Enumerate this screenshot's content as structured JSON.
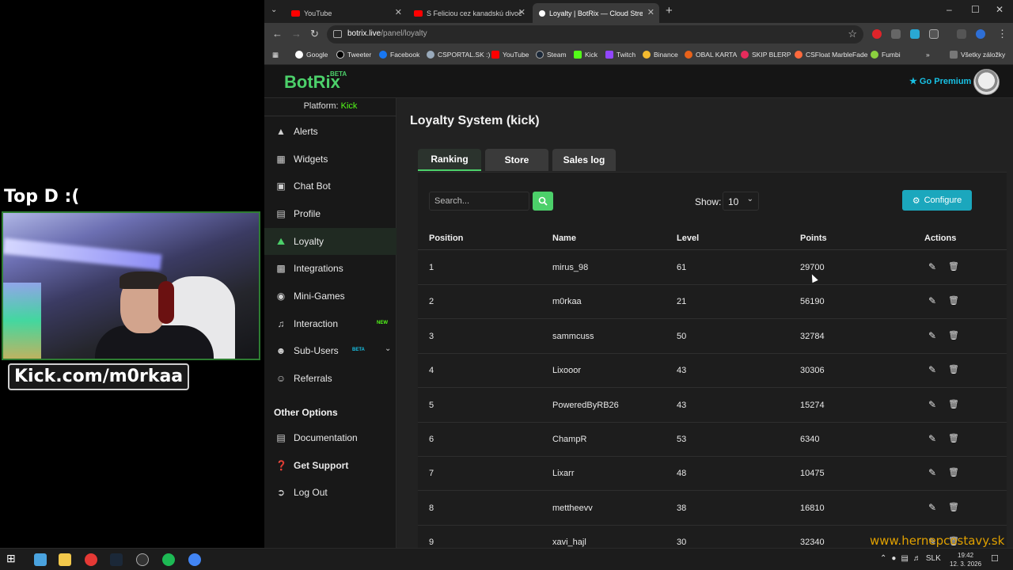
{
  "overlay": {
    "caption": "Top D :(",
    "kick_channel": "Kick.com/m0rkaa"
  },
  "browser": {
    "tabs": [
      {
        "title": "YouTube",
        "icon": "youtube-icon"
      },
      {
        "title": "S Feliciou cez kanadskú divočin",
        "icon": "youtube-icon"
      },
      {
        "title": "Loyalty | BotRix — Cloud Strea",
        "icon": "botrix-icon"
      }
    ],
    "url_host": "botrix.live",
    "url_path": "/panel/loyalty",
    "bookmarks": [
      "Google",
      "Tweeter",
      "Facebook",
      "CSPORTAL.SK :)",
      "YouTube",
      "Steam",
      "Kick",
      "Twitch",
      "Binance",
      "OBAL KARTA",
      "SKIP BLERP",
      "CSFloat MarbleFade",
      "Fumbi"
    ],
    "all_bookmarks": "Všetky záložky"
  },
  "header": {
    "logo": "BotRix",
    "logo_badge": "BETA",
    "premium": "Go Premium"
  },
  "sidebar": {
    "platform_label": "Platform:",
    "platform_value": "Kick",
    "items": [
      {
        "label": "Alerts",
        "icon": "warning-icon"
      },
      {
        "label": "Widgets",
        "icon": "grid-icon"
      },
      {
        "label": "Chat Bot",
        "icon": "robot-icon"
      },
      {
        "label": "Profile",
        "icon": "id-card-icon"
      },
      {
        "label": "Loyalty",
        "icon": "trophy-icon"
      },
      {
        "label": "Integrations",
        "icon": "puzzle-icon"
      },
      {
        "label": "Mini-Games",
        "icon": "gamepad-icon"
      },
      {
        "label": "Interaction",
        "icon": "music-icon",
        "badge": "NEW"
      },
      {
        "label": "Sub-Users",
        "icon": "users-icon",
        "badge": "BETA"
      },
      {
        "label": "Referrals",
        "icon": "user-group-icon"
      }
    ],
    "other_options_title": "Other Options",
    "other_items": [
      {
        "label": "Documentation",
        "icon": "book-icon"
      },
      {
        "label": "Get Support",
        "icon": "question-icon"
      },
      {
        "label": "Log Out",
        "icon": "logout-icon"
      }
    ],
    "colors": {
      "accent": "#4cd06a",
      "kick": "#53fc18",
      "new_badge": "#53fc18",
      "beta_badge": "#18c1e4"
    }
  },
  "main": {
    "title": "Loyalty System (kick)",
    "tabs": [
      "Ranking",
      "Store",
      "Sales log"
    ],
    "search_placeholder": "Search...",
    "show_label": "Show:",
    "show_value": "10",
    "configure_label": "Configure",
    "columns": [
      "Position",
      "Name",
      "Level",
      "Points",
      "Actions"
    ],
    "rows": [
      {
        "position": "1",
        "name": "mirus_98",
        "level": "61",
        "points": "29700"
      },
      {
        "position": "2",
        "name": "m0rkaa",
        "level": "21",
        "points": "56190"
      },
      {
        "position": "3",
        "name": "sammcuss",
        "level": "50",
        "points": "32784"
      },
      {
        "position": "4",
        "name": "Lixooor",
        "level": "43",
        "points": "30306"
      },
      {
        "position": "5",
        "name": "PoweredByRB26",
        "level": "43",
        "points": "15274"
      },
      {
        "position": "6",
        "name": "ChampR",
        "level": "53",
        "points": "6340"
      },
      {
        "position": "7",
        "name": "Lixarr",
        "level": "48",
        "points": "10475"
      },
      {
        "position": "8",
        "name": "mettheevv",
        "level": "38",
        "points": "16810"
      },
      {
        "position": "9",
        "name": "xavi_hajl",
        "level": "30",
        "points": "32340"
      }
    ]
  },
  "watermark": "www.hernepcostavy.sk",
  "taskbar": {
    "language": "SLK",
    "time": "19:42",
    "date": "12. 3. 2026"
  }
}
